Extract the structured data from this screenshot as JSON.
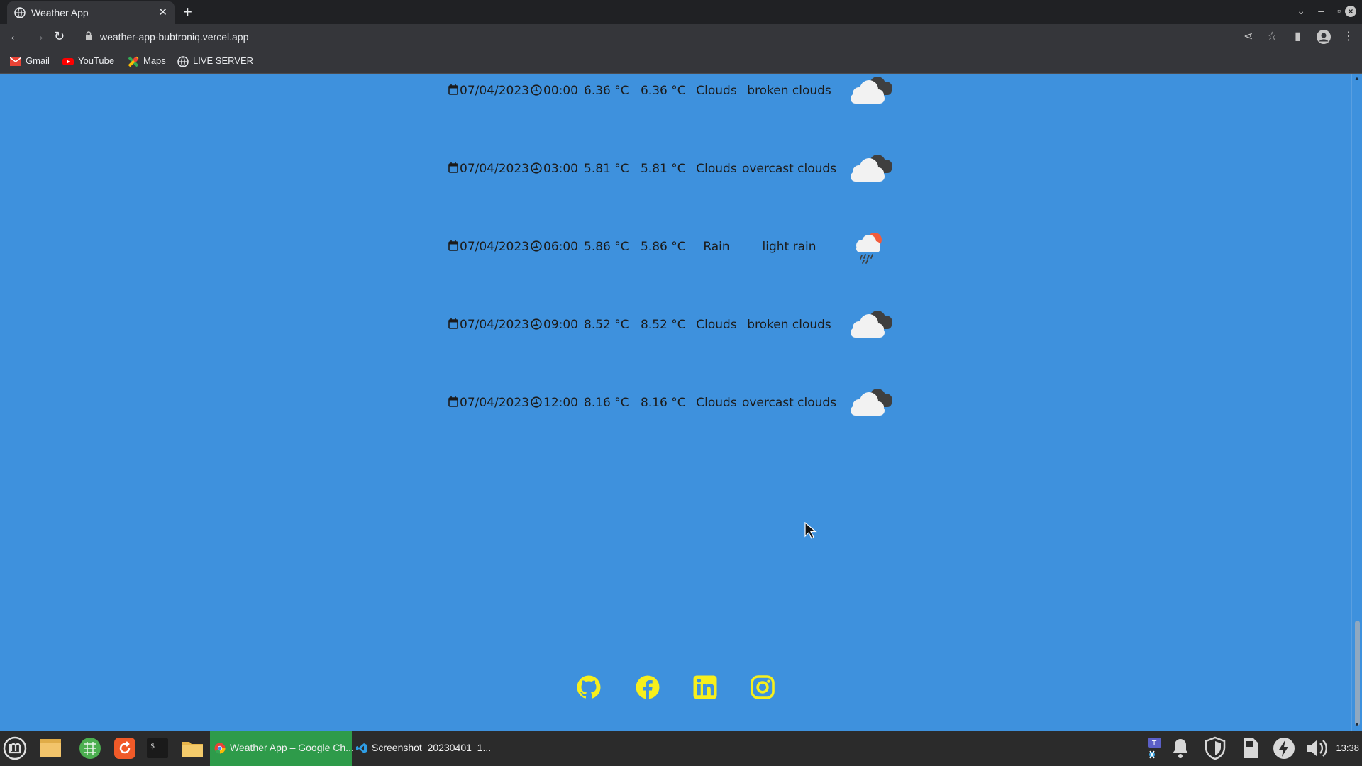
{
  "browser": {
    "tab_title": "Weather App",
    "url": "weather-app-bubtroniq.vercel.app",
    "bookmarks": [
      {
        "label": "Gmail"
      },
      {
        "label": "YouTube"
      },
      {
        "label": "Maps"
      },
      {
        "label": "LIVE SERVER"
      }
    ]
  },
  "forecast": [
    {
      "date": "07/04/2023 -",
      "time": "00:00",
      "temp": "6.36 °C",
      "feels": "6.36 °C",
      "main": "Clouds",
      "desc": "broken clouds",
      "icon": "broken-clouds-icon"
    },
    {
      "date": "07/04/2023 -",
      "time": "03:00",
      "temp": "5.81 °C",
      "feels": "5.81 °C",
      "main": "Clouds",
      "desc": "overcast clouds",
      "icon": "overcast-clouds-icon"
    },
    {
      "date": "07/04/2023 -",
      "time": "06:00",
      "temp": "5.86 °C",
      "feels": "5.86 °C",
      "main": "Rain",
      "desc": "light rain",
      "icon": "light-rain-icon"
    },
    {
      "date": "07/04/2023 -",
      "time": "09:00",
      "temp": "8.52 °C",
      "feels": "8.52 °C",
      "main": "Clouds",
      "desc": "broken clouds",
      "icon": "broken-clouds-icon"
    },
    {
      "date": "07/04/2023 -",
      "time": "12:00",
      "temp": "8.16 °C",
      "feels": "8.16 °C",
      "main": "Clouds",
      "desc": "overcast clouds",
      "icon": "overcast-clouds-icon"
    }
  ],
  "socials": [
    "github-icon",
    "facebook-icon",
    "linkedin-icon",
    "instagram-icon"
  ],
  "colors": {
    "page_bg": "#3e91dd",
    "social": "#f7ef1c",
    "taskbar": "#2b2b2b",
    "active_window": "#2e9b4a"
  },
  "taskbar": {
    "windows": [
      {
        "label": "Weather App – Google Ch..."
      },
      {
        "label": "Screenshot_20230401_1..."
      }
    ],
    "clock": "13:38"
  }
}
